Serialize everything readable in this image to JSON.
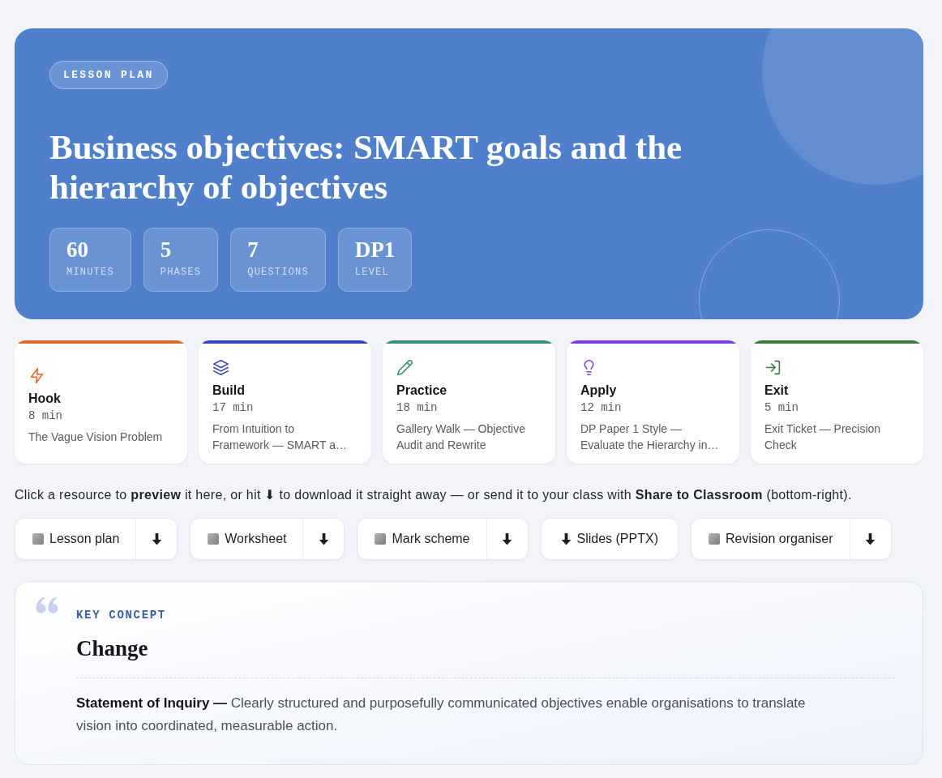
{
  "hero": {
    "badge": "LESSON PLAN",
    "title": "Business objectives: SMART goals and the hierarchy of objectives",
    "stats": [
      {
        "value": "60",
        "label": "MINUTES"
      },
      {
        "value": "5",
        "label": "PHASES"
      },
      {
        "value": "7",
        "label": "QUESTIONS"
      },
      {
        "value": "DP1",
        "label": "LEVEL"
      }
    ]
  },
  "phases": [
    {
      "kind": "hook",
      "title": "Hook",
      "duration": "8 min",
      "description": "The Vague Vision Problem",
      "color": "#e0692e"
    },
    {
      "kind": "build",
      "title": "Build",
      "duration": "17 min",
      "description": "From Intuition to Framework — SMART a…",
      "color": "#3642c4"
    },
    {
      "kind": "practice",
      "title": "Practice",
      "duration": "18 min",
      "description": "Gallery Walk — Objective Audit and Rewrite",
      "color": "#3a8c7c"
    },
    {
      "kind": "apply",
      "title": "Apply",
      "duration": "12 min",
      "description": "DP Paper 1 Style — Evaluate the Hierarchy in…",
      "color": "#7b3fe0"
    },
    {
      "kind": "exit",
      "title": "Exit",
      "duration": "5 min",
      "description": "Exit Ticket — Precision Check",
      "color": "#3c7a3e"
    }
  ],
  "instructions": "Click a resource to **preview** it here, or hit ⬇ to download it straight away — or send it to your class with **Share to Classroom** (bottom-right).",
  "resources": [
    {
      "label": "Lesson plan",
      "kind": "preview"
    },
    {
      "label": "Worksheet",
      "kind": "preview"
    },
    {
      "label": "Mark scheme",
      "kind": "preview"
    },
    {
      "label": "Slides (PPTX)",
      "kind": "download"
    },
    {
      "label": "Revision organiser",
      "kind": "preview"
    }
  ],
  "key_concept": {
    "label": "KEY CONCEPT",
    "title": "Change",
    "statement": "**Statement of Inquiry —** Clearly structured and purposefully communicated objectives enable organisations to translate vision into coordinated, measurable action."
  }
}
